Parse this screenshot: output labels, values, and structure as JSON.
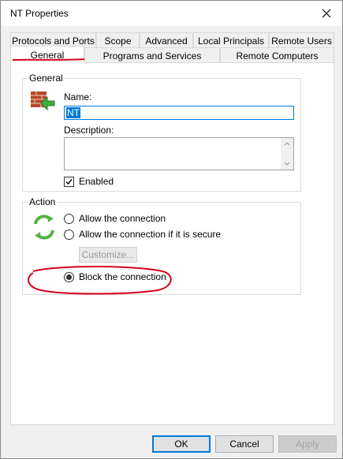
{
  "window": {
    "title": "NT Properties"
  },
  "tabs_row1": [
    "Protocols and Ports",
    "Scope",
    "Advanced",
    "Local Principals",
    "Remote Users"
  ],
  "tabs_row2": [
    "General",
    "Programs and Services",
    "Remote Computers"
  ],
  "active_tab": "General",
  "general_group": {
    "legend": "General",
    "name_label": "Name:",
    "name_value": "NT",
    "description_label": "Description:",
    "description_value": "",
    "enabled_label": "Enabled",
    "enabled_checked": true
  },
  "action_group": {
    "legend": "Action",
    "options": [
      {
        "label": "Allow the connection",
        "selected": false
      },
      {
        "label": "Allow the connection if it is secure",
        "selected": false
      },
      {
        "label": "Block the connection",
        "selected": true
      }
    ],
    "customize_label": "Customize..."
  },
  "footer": {
    "ok": "OK",
    "cancel": "Cancel",
    "apply": "Apply"
  },
  "colors": {
    "accent": "#0078d7",
    "annotation": "#d9001b"
  },
  "icons": [
    "firewall-rule-icon",
    "action-arrows-icon",
    "close-icon",
    "checkmark-icon",
    "scroll-up-icon",
    "scroll-down-icon"
  ]
}
